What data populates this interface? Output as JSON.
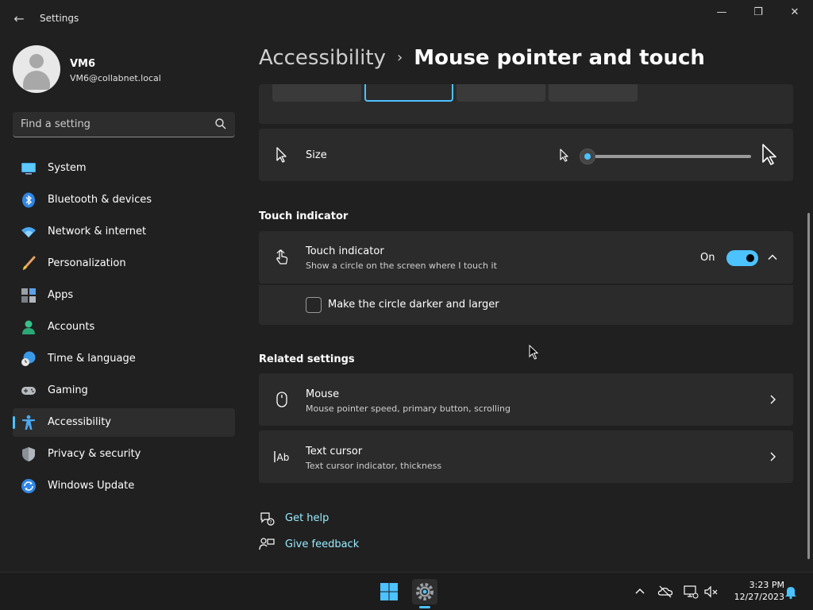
{
  "window": {
    "title": "Settings",
    "minimize_glyph": "—",
    "maximize_glyph": "❐",
    "close_glyph": "✕",
    "back_glyph": "←"
  },
  "user": {
    "name": "VM6",
    "email": "VM6@collabnet.local"
  },
  "search": {
    "placeholder": "Find a setting"
  },
  "sidebar": {
    "items": [
      {
        "label": "System",
        "icon": "system-icon"
      },
      {
        "label": "Bluetooth & devices",
        "icon": "bluetooth-icon"
      },
      {
        "label": "Network & internet",
        "icon": "wifi-icon"
      },
      {
        "label": "Personalization",
        "icon": "brush-icon"
      },
      {
        "label": "Apps",
        "icon": "apps-icon"
      },
      {
        "label": "Accounts",
        "icon": "person-icon"
      },
      {
        "label": "Time & language",
        "icon": "globe-clock-icon"
      },
      {
        "label": "Gaming",
        "icon": "gamepad-icon"
      },
      {
        "label": "Accessibility",
        "icon": "accessibility-icon",
        "active": true
      },
      {
        "label": "Privacy & security",
        "icon": "shield-icon"
      },
      {
        "label": "Windows Update",
        "icon": "update-icon"
      }
    ]
  },
  "header": {
    "parent": "Accessibility",
    "separator": "›",
    "current": "Mouse pointer and touch"
  },
  "size_setting": {
    "label": "Size",
    "slider_value_fraction": 0.02
  },
  "touch_section": {
    "title": "Touch indicator",
    "row_title": "Touch indicator",
    "row_subtitle": "Show a circle on the screen where I touch it",
    "toggle_state": "On",
    "checkbox_label": "Make the circle darker and larger"
  },
  "related_section": {
    "title": "Related settings",
    "items": [
      {
        "title": "Mouse",
        "subtitle": "Mouse pointer speed, primary button, scrolling"
      },
      {
        "title": "Text cursor",
        "subtitle": "Text cursor indicator, thickness"
      }
    ]
  },
  "links": {
    "help": "Get help",
    "feedback": "Give feedback"
  },
  "taskbar": {
    "time": "3:23 PM",
    "date": "12/27/2023"
  },
  "colors": {
    "accent": "#4cc2ff",
    "background": "#202020",
    "card": "#2b2b2b",
    "link": "#99ebff"
  }
}
